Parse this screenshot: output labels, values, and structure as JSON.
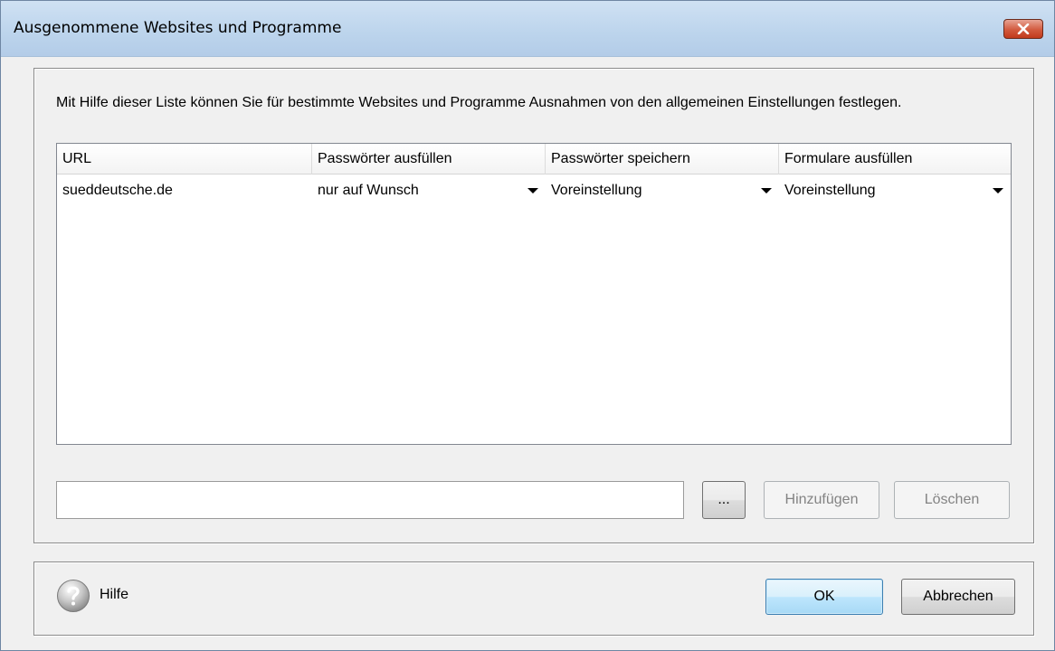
{
  "window": {
    "title": "Ausgenommene Websites und Programme"
  },
  "description": "Mit Hilfe dieser Liste können Sie für bestimmte Websites und Programme Ausnahmen von den allgemeinen Einstellungen festlegen.",
  "table": {
    "columns": [
      "URL",
      "Passwörter ausfüllen",
      "Passwörter speichern",
      "Formulare ausfüllen"
    ],
    "rows": [
      {
        "url": "sueddeutsche.de",
        "fill_passwords": "nur auf Wunsch",
        "save_passwords": "Voreinstellung",
        "fill_forms": "Voreinstellung"
      }
    ]
  },
  "url_input": {
    "value": "",
    "placeholder": ""
  },
  "buttons": {
    "browse": "...",
    "add": "Hinzufügen",
    "delete": "Löschen",
    "ok": "OK",
    "cancel": "Abbrechen"
  },
  "help": {
    "label": "Hilfe",
    "icon": "help-icon"
  }
}
